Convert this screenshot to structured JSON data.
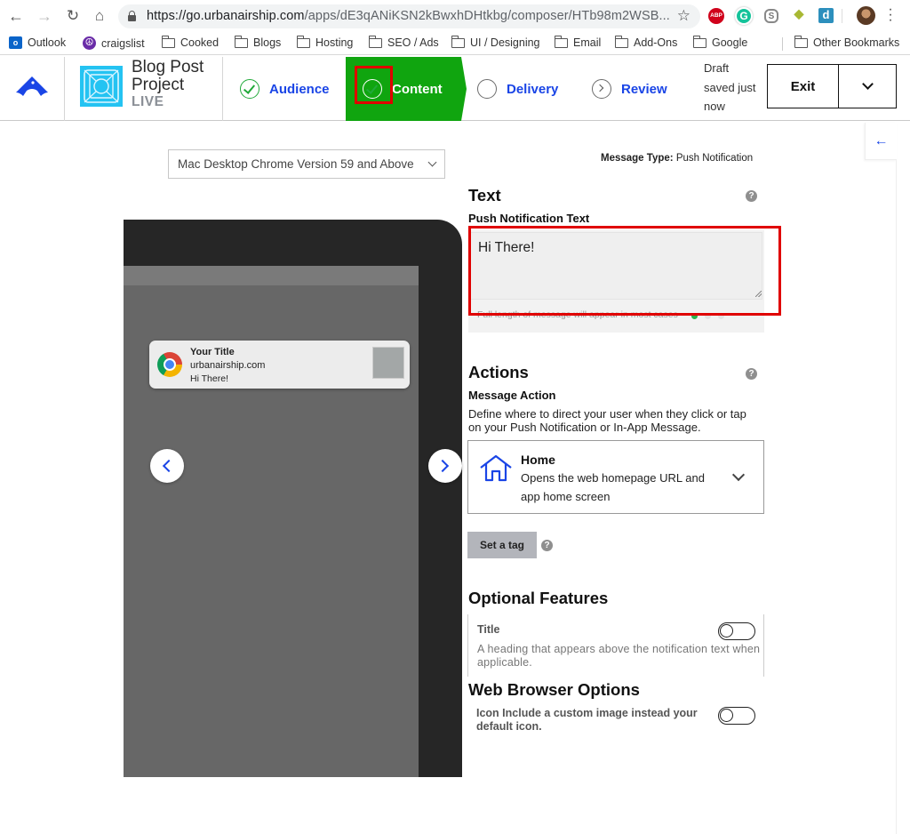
{
  "browser": {
    "url_host": "https://go.urbanairship.com",
    "url_rest": "/apps/dE3qANiKSN2kBwxhDHtkbg/composer/HTb98m2WSB...",
    "extensions": [
      "adblock-plus",
      "grammarly",
      "skype",
      "gem",
      "d-extension"
    ],
    "abp_label": "ABP",
    "grammarly_label": "G",
    "skype_label": "S",
    "d_label": "d",
    "bookmarks": [
      {
        "label": "Outlook",
        "icon": "outlook-icon"
      },
      {
        "label": "craigslist",
        "icon": "peace-icon"
      },
      {
        "label": "Cooked",
        "icon": "folder-icon"
      },
      {
        "label": "Blogs",
        "icon": "folder-icon"
      },
      {
        "label": "Hosting",
        "icon": "folder-icon"
      },
      {
        "label": "SEO / Ads",
        "icon": "folder-icon"
      },
      {
        "label": "UI / Designing",
        "icon": "folder-icon"
      },
      {
        "label": "Email",
        "icon": "folder-icon"
      },
      {
        "label": "Add-Ons",
        "icon": "folder-icon"
      },
      {
        "label": "Google",
        "icon": "folder-icon"
      }
    ],
    "other_bookmarks": "Other Bookmarks"
  },
  "header": {
    "project_title_line1": "Blog Post",
    "project_title_line2": "Project",
    "project_status": "LIVE",
    "steps": [
      {
        "label": "Audience",
        "state": "complete"
      },
      {
        "label": "Content",
        "state": "active"
      },
      {
        "label": "Delivery",
        "state": "pending"
      },
      {
        "label": "Review",
        "state": "next"
      }
    ],
    "draft_line1": "Draft",
    "draft_line2": "saved just",
    "draft_line3": "now",
    "exit_label": "Exit"
  },
  "preview": {
    "device_select": "Mac Desktop Chrome Version 59 and Above",
    "notification": {
      "title": "Your Title",
      "site": "urbanairship.com",
      "body": "Hi There!"
    }
  },
  "form": {
    "message_type_label": "Message Type:",
    "message_type_value": "Push Notification",
    "text_section": {
      "heading": "Text",
      "field_label": "Push Notification Text",
      "value": "Hi There!",
      "hint": "Full length of message will appear in most cases",
      "indicator_colors": [
        "#2bb24c",
        "#e2e2e2",
        "#e2e2e2"
      ]
    },
    "actions_section": {
      "heading": "Actions",
      "field_label": "Message Action",
      "description": "Define where to direct your user when they click or tap on your Push Notification or In-App Message.",
      "selected_action_title": "Home",
      "selected_action_desc": "Opens the web homepage URL and app home screen",
      "tag_button": "Set a tag"
    },
    "optional_features": {
      "heading": "Optional Features",
      "title_option": "Title",
      "title_desc": "A heading that appears above the notification text when applicable.",
      "title_enabled": false
    },
    "web_browser_options": {
      "heading": "Web Browser Options",
      "icon_option": "Icon Include a custom image instead your default icon.",
      "icon_enabled": false
    }
  },
  "colors": {
    "accent_blue": "#1a45e6",
    "active_step_green": "#10a50f",
    "highlight_red": "#e00000",
    "project_icon": "#24c3f2"
  }
}
